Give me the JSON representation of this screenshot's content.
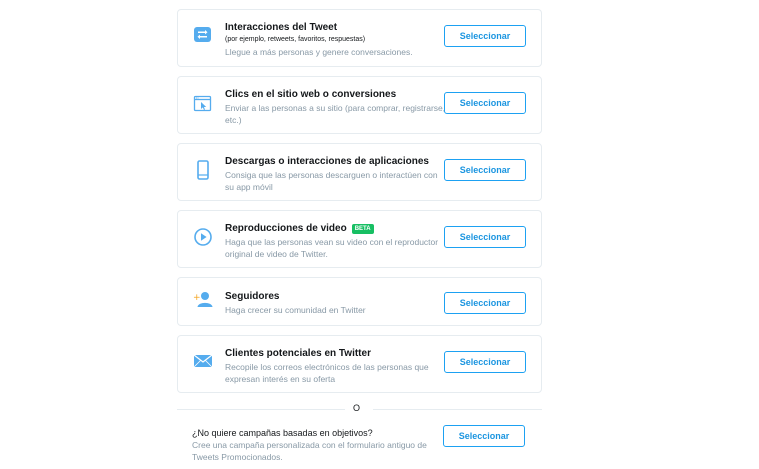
{
  "objectives": [
    {
      "icon": "retweet-icon",
      "title": "Interacciones del Tweet",
      "subnote": "(por ejemplo, retweets, favoritos, respuestas)",
      "description": "Llegue a más personas y genere conversaciones.",
      "button": "Seleccionar"
    },
    {
      "icon": "website-click-icon",
      "title": "Clics en el sitio web o conversiones",
      "description": "Enviar a las personas a su sitio (para comprar, registrarse, etc.)",
      "button": "Seleccionar"
    },
    {
      "icon": "mobile-app-icon",
      "title": "Descargas o interacciones de aplicaciones",
      "description": "Consiga que las personas descarguen o interactúen con su app móvil",
      "button": "Seleccionar"
    },
    {
      "icon": "play-icon",
      "title": "Reproducciones de video",
      "badge": "BETA",
      "description": "Haga que las personas vean su video con el reproductor original de video de Twitter.",
      "button": "Seleccionar"
    },
    {
      "icon": "followers-icon",
      "title": "Seguidores",
      "description": "Haga crecer su comunidad en Twitter",
      "button": "Seleccionar"
    },
    {
      "icon": "envelope-icon",
      "title": "Clientes potenciales en Twitter",
      "description": "Recopile los correos electrónicos de las personas que expresan interés en su oferta",
      "button": "Seleccionar"
    }
  ],
  "separator": "O",
  "custom": {
    "title": "¿No quiere campañas basadas en objetivos?",
    "description": "Cree una campaña personalizada con el formulario antiguo de Tweets Promocionados.",
    "button": "Seleccionar"
  },
  "colors": {
    "accent": "#1da1f2",
    "icon": "#55acee",
    "beta": "#17bf63"
  }
}
